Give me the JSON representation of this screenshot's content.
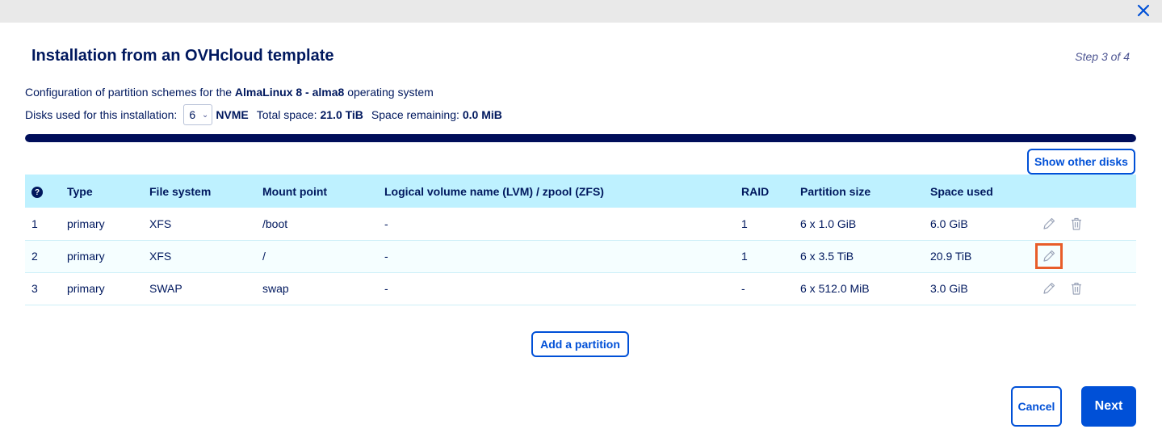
{
  "dialog": {
    "title": "Installation from an OVHcloud template",
    "step": "Step 3 of 4",
    "config_prefix": "Configuration of partition schemes for the ",
    "os_name": "AlmaLinux 8 - alma8",
    "config_suffix": " operating system",
    "disks_label": "Disks used for this installation:",
    "disks_count": "6",
    "disk_type": "NVME",
    "total_label": "Total space:",
    "total_value": "21.0 TiB",
    "remaining_label": "Space remaining:",
    "remaining_value": "0.0 MiB",
    "space_used_fraction": 1.0
  },
  "buttons": {
    "show_other_disks": "Show other disks",
    "add_partition": "Add a partition",
    "cancel": "Cancel",
    "next": "Next"
  },
  "table": {
    "help_glyph": "?",
    "headers": [
      "Type",
      "File system",
      "Mount point",
      "Logical volume name (LVM) / zpool (ZFS)",
      "RAID",
      "Partition size",
      "Space used"
    ],
    "rows": [
      {
        "num": "1",
        "type": "primary",
        "fs": "XFS",
        "mount": "/boot",
        "lvm": "-",
        "raid": "1",
        "size": "6 x 1.0 GiB",
        "used": "6.0 GiB"
      },
      {
        "num": "2",
        "type": "primary",
        "fs": "XFS",
        "mount": "/",
        "lvm": "-",
        "raid": "1",
        "size": "6 x 3.5 TiB",
        "used": "20.9 TiB"
      },
      {
        "num": "3",
        "type": "primary",
        "fs": "SWAP",
        "mount": "swap",
        "lvm": "-",
        "raid": "-",
        "size": "6 x 512.0 MiB",
        "used": "3.0 GiB"
      }
    ]
  },
  "colors": {
    "accent": "#0050d7",
    "highlight": "#e85d2a",
    "header_bg": "#bef1ff"
  }
}
